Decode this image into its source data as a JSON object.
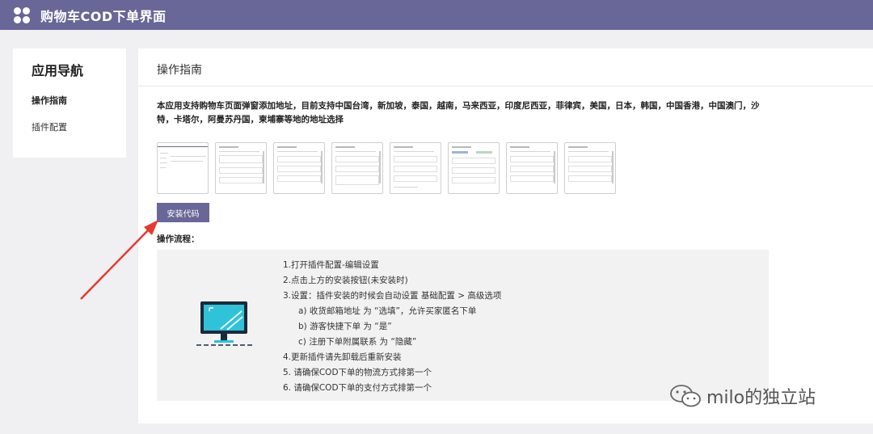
{
  "header": {
    "title": "购物车COD下单界面",
    "logo_icon": "four-dots-logo-icon",
    "background": "#686797"
  },
  "sidebar": {
    "title": "应用导航",
    "items": [
      {
        "label": "操作指南",
        "active": true
      },
      {
        "label": "插件配置",
        "active": false
      }
    ]
  },
  "main": {
    "title": "操作指南",
    "description": "本应用支持购物车页面弹窗添加地址，目前支持中国台湾，新加坡，泰国，越南，马来西亚，印度尼西亚，菲律宾，美国，日本，韩国，中国香港，中国澳门，沙特，卡塔尔，阿曼苏丹国，柬埔寨等地的地址选择",
    "thumbnails_count": 8,
    "install_button": "安装代码",
    "flow_label": "操作流程：",
    "steps": [
      {
        "text": "1.打开插件配置-编辑设置",
        "sub": false
      },
      {
        "text": "2.点击上方的安装按钮(未安装时)",
        "sub": false
      },
      {
        "text": "3.设置：插件安装的时候会自动设置 基础配置 > 高级选项",
        "sub": false
      },
      {
        "text": "a) 收货邮箱地址 为 “选填”，允许买家匿名下单",
        "sub": true
      },
      {
        "text": "b) 游客快捷下单 为 “是”",
        "sub": true
      },
      {
        "text": "c) 注册下单附属联系 为 “隐藏”",
        "sub": true
      },
      {
        "text": "4.更新插件请先卸载后重新安装",
        "sub": false
      },
      {
        "text": "5. 请确保COD下单的物流方式排第一个",
        "sub": false
      },
      {
        "text": "6. 请确保COD下单的支付方式排第一个",
        "sub": false
      }
    ]
  },
  "watermark": {
    "text": "milo的独立站",
    "icon": "wechat-icon"
  },
  "annotation": {
    "arrow_color": "#e8392c"
  }
}
